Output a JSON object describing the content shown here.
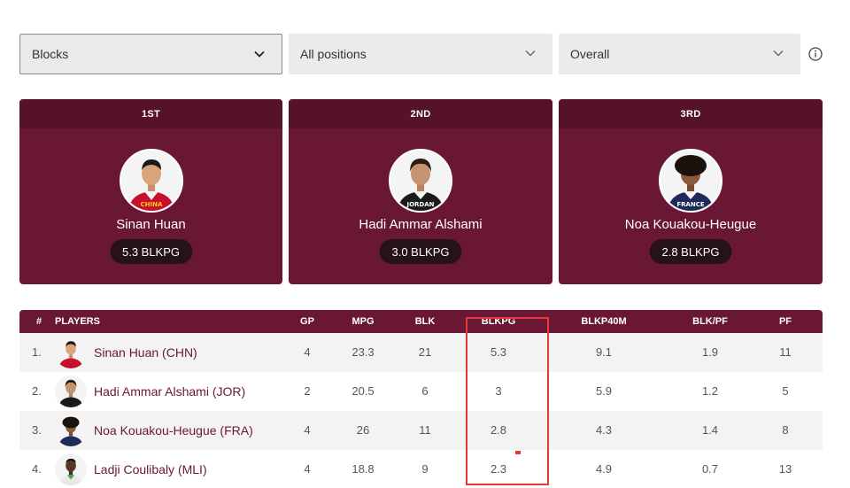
{
  "filters": {
    "stat": "Blocks",
    "position": "All positions",
    "scope": "Overall"
  },
  "podium": [
    {
      "rank": "1ST",
      "name": "Sinan Huan",
      "stat": "5.3 BLKPG",
      "jersey": "CHINA",
      "jersey_color": "#c8102e"
    },
    {
      "rank": "2ND",
      "name": "Hadi Ammar Alshami",
      "stat": "3.0 BLKPG",
      "jersey": "JORDAN",
      "jersey_color": "#1b1b1b"
    },
    {
      "rank": "3RD",
      "name": "Noa Kouakou-Heugue",
      "stat": "2.8 BLKPG",
      "jersey": "FRANCE",
      "jersey_color": "#1d2a5b"
    }
  ],
  "table": {
    "headers": {
      "rank": "#",
      "players": "PLAYERS",
      "gp": "GP",
      "mpg": "MPG",
      "blk": "BLK",
      "blkpg": "BLKPG",
      "blk40": "BLKP40M",
      "blkpf": "BLK/PF",
      "pf": "PF"
    },
    "rows": [
      {
        "num": "1.",
        "name": "Sinan Huan (CHN)",
        "gp": "4",
        "mpg": "23.3",
        "blk": "21",
        "blkpg": "5.3",
        "blk40": "9.1",
        "blkpf": "1.9",
        "pf": "11"
      },
      {
        "num": "2.",
        "name": "Hadi Ammar Alshami (JOR)",
        "gp": "2",
        "mpg": "20.5",
        "blk": "6",
        "blkpg": "3",
        "blk40": "5.9",
        "blkpf": "1.2",
        "pf": "5"
      },
      {
        "num": "3.",
        "name": "Noa Kouakou-Heugue (FRA)",
        "gp": "4",
        "mpg": "26",
        "blk": "11",
        "blkpg": "2.8",
        "blk40": "4.3",
        "blkpf": "1.4",
        "pf": "8"
      },
      {
        "num": "4.",
        "name": "Ladji Coulibaly (MLI)",
        "gp": "4",
        "mpg": "18.8",
        "blk": "9",
        "blkpg": "2.3",
        "blk40": "4.9",
        "blkpf": "0.7",
        "pf": "13"
      }
    ]
  },
  "colors": {
    "primary": "#6a1735",
    "header_dark": "#561228",
    "highlight": "#e53935"
  }
}
